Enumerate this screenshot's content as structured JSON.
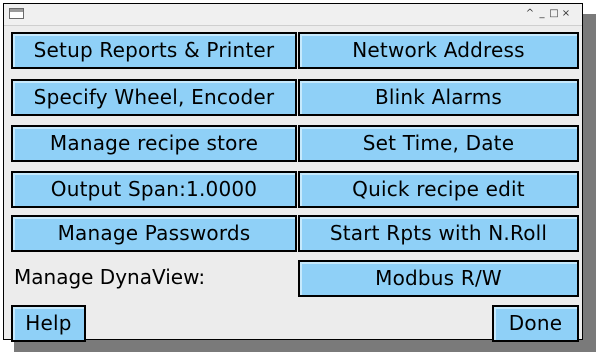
{
  "window": {
    "title": "",
    "controls": [
      "^",
      "_",
      "□",
      "×"
    ]
  },
  "left_buttons": [
    {
      "label": "Setup Reports & Printer"
    },
    {
      "label": "Specify Wheel, Encoder"
    },
    {
      "label": "Manage recipe store"
    },
    {
      "label": "Output Span:1.0000"
    },
    {
      "label": "Manage Passwords"
    }
  ],
  "right_buttons": [
    {
      "label": "Network Address"
    },
    {
      "label": "Blink Alarms"
    },
    {
      "label": "Set Time, Date"
    },
    {
      "label": "Quick recipe edit"
    },
    {
      "label": "Start Rpts with N.Roll"
    },
    {
      "label": "Modbus R/W"
    }
  ],
  "dynaview_label": "Manage DynaView:",
  "help_label": "Help",
  "done_label": "Done",
  "colors": {
    "button_fill": "#8fd0f7",
    "window_bg": "#ececec",
    "shadow": "#7a7a7a"
  }
}
